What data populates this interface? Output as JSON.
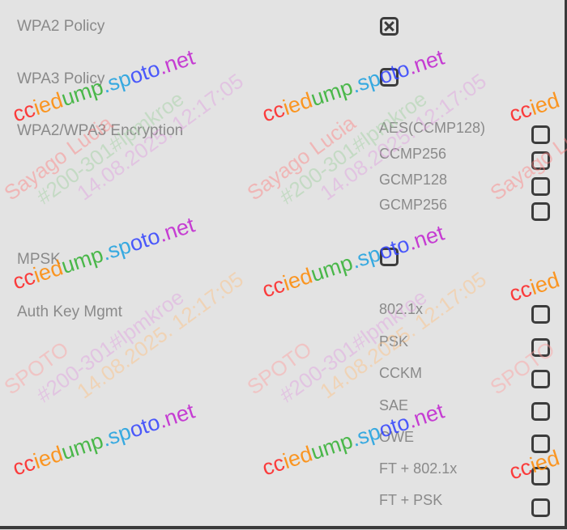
{
  "settings": {
    "wpa2_policy": {
      "label": "WPA2 Policy",
      "checked": true
    },
    "wpa3_policy": {
      "label": "WPA3 Policy",
      "checked": false
    },
    "encryption": {
      "label": "WPA2/WPA3 Encryption",
      "options": [
        {
          "label": "AES(CCMP128)",
          "checked": false
        },
        {
          "label": "CCMP256",
          "checked": false
        },
        {
          "label": "GCMP128",
          "checked": false
        },
        {
          "label": "GCMP256",
          "checked": false
        }
      ]
    },
    "mpsk": {
      "label": "MPSK",
      "checked": false
    },
    "akm": {
      "label": "Auth Key Mgmt",
      "options": [
        {
          "label": "802.1x",
          "checked": false
        },
        {
          "label": "PSK",
          "checked": false
        },
        {
          "label": "CCKM",
          "checked": false
        },
        {
          "label": "SAE",
          "checked": false
        },
        {
          "label": "OWE",
          "checked": false
        },
        {
          "label": "FT + 802.1x",
          "checked": false
        },
        {
          "label": "FT + PSK",
          "checked": false
        }
      ]
    }
  },
  "watermark": {
    "site": "cciedump.spoto.net",
    "name1": "Sayago Lucia",
    "name2": "SPOTO",
    "exam": "#200-301#lpmkroe",
    "datetime": "14.08.2025. 12:17:05"
  }
}
